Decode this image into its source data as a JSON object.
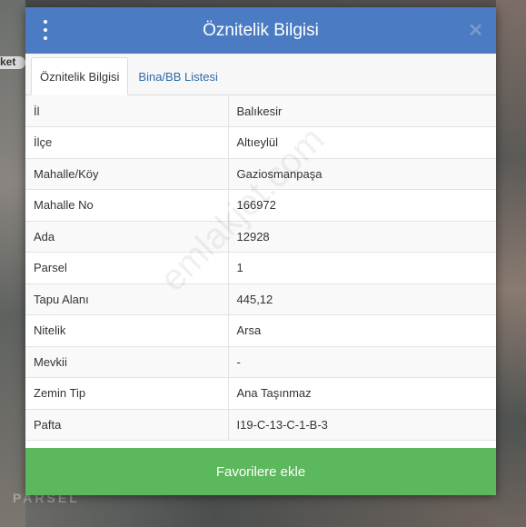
{
  "dialog": {
    "title": "Öznitelik Bilgisi",
    "close_symbol": "✕"
  },
  "background": {
    "road_label": "ket",
    "logo": "PARSEL"
  },
  "tabs": [
    {
      "label": "Öznitelik Bilgisi",
      "active": true
    },
    {
      "label": "Bina/BB Listesi",
      "active": false
    }
  ],
  "attributes": [
    {
      "key": "İl",
      "value": "Balıkesir"
    },
    {
      "key": "İlçe",
      "value": "Altıeylül"
    },
    {
      "key": "Mahalle/Köy",
      "value": "Gaziosmanpaşa"
    },
    {
      "key": "Mahalle No",
      "value": "166972"
    },
    {
      "key": "Ada",
      "value": "12928"
    },
    {
      "key": "Parsel",
      "value": "1"
    },
    {
      "key": "Tapu Alanı",
      "value": "445,12"
    },
    {
      "key": "Nitelik",
      "value": "Arsa"
    },
    {
      "key": "Mevkii",
      "value": "-"
    },
    {
      "key": "Zemin Tip",
      "value": "Ana Taşınmaz"
    },
    {
      "key": "Pafta",
      "value": "I19-C-13-C-1-B-3"
    }
  ],
  "footer": {
    "favorite_label": "Favorilere ekle"
  },
  "watermark": "emlakjet.com",
  "colors": {
    "header": "#4a7bc3",
    "favorite_button": "#5cb85c",
    "tab_link": "#2f6aa8"
  }
}
